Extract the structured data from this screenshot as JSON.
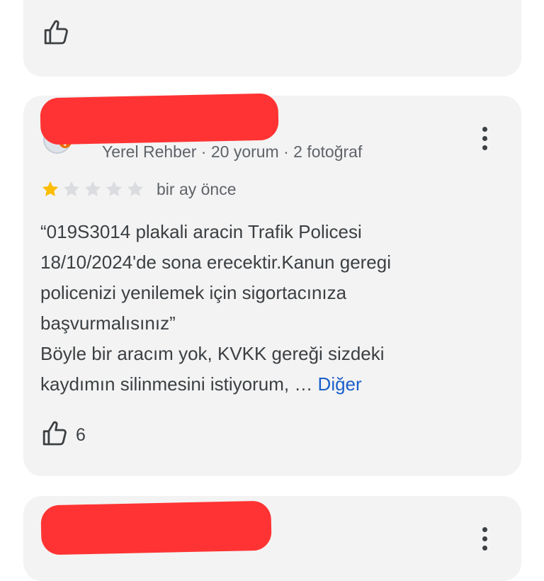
{
  "reviews": {
    "main": {
      "reviewer_stats": "Yerel Rehber · 20 yorum · 2 fotoğraf",
      "rating": 1,
      "max_rating": 5,
      "date": "bir ay önce",
      "text_lines": [
        "“019S3014 plakali aracin Trafik Policesi",
        "18/10/2024'de sona erecektir.Kanun geregi",
        "policenizi yenilemek için sigortacınıza",
        "başvurmalısınız”",
        "Böyle bir aracım yok, KVKK gereği sizdeki",
        "kaydımın silinmesini istiyorum, …"
      ],
      "more_label": "Diğer",
      "like_count": "6"
    }
  },
  "icons": {
    "like": "thumb-up-icon",
    "menu": "more-vert-icon",
    "star": "star-icon"
  },
  "colors": {
    "card_background": "#f3f3f3",
    "star_filled": "#fbbc04",
    "star_empty": "#dadce0",
    "link": "#1a5fcb",
    "redaction": "#ff3333",
    "badge": "#e8710a"
  }
}
